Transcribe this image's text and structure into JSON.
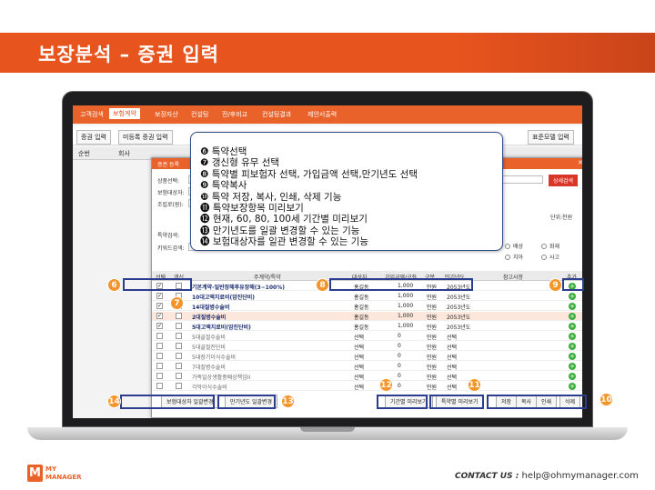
{
  "slide": {
    "title": "보장분석 – 증권 입력"
  },
  "app": {
    "nav": [
      "고객검색",
      "보험계약",
      "보장자산",
      "컨설팅",
      "전/후비교",
      "컨설팅결과",
      "제안서출력"
    ],
    "active_nav_index": 1,
    "sub_tabs": [
      "증권 입력",
      "미등록 증권 입력"
    ],
    "right_button": "표준모델 입력",
    "grid_headers": [
      "순번",
      "회사"
    ],
    "accent_color": "#e9622a"
  },
  "dialog": {
    "title": "증권 등록",
    "labels": [
      "상품선택:",
      "보험대상자:",
      "조립로(원):",
      "특약검색:",
      "키워드검색:"
    ],
    "search_button": "상세검색",
    "right_label": "단위:천원",
    "radio_options": [
      "배상",
      "화재",
      "치아",
      "사고"
    ],
    "table_headers": [
      "선택",
      "갱신",
      "주계약/특약",
      "대상자",
      "가입금액/구좌",
      "구분",
      "만기년도",
      "참고사항",
      "추가"
    ],
    "rows": [
      {
        "name": "기본계약-일반장해후유장해(3~100%)",
        "person": "홍길동",
        "amount": "1,000",
        "unit": "만원",
        "year": "2053년도",
        "checked": true,
        "bold": true,
        "selected": false
      },
      {
        "name": "10대고액치료비(암진단비)",
        "person": "홍길동",
        "amount": "1,000",
        "unit": "만원",
        "year": "2053년도",
        "checked": true,
        "bold": true,
        "selected": false
      },
      {
        "name": "14대질병수술비",
        "person": "홍길동",
        "amount": "1,000",
        "unit": "만원",
        "year": "2053년도",
        "checked": true,
        "bold": true,
        "selected": false
      },
      {
        "name": "2대질병수술비",
        "person": "홍길동",
        "amount": "1,000",
        "unit": "만원",
        "year": "2053년도",
        "checked": true,
        "bold": true,
        "selected": true
      },
      {
        "name": "5대고액치료비(암진단비)",
        "person": "홍길동",
        "amount": "1,000",
        "unit": "만원",
        "year": "2053년도",
        "checked": true,
        "bold": true,
        "selected": false
      },
      {
        "name": "5대골절수술비",
        "person": "선택",
        "amount": "0",
        "unit": "만원",
        "year": "선택",
        "checked": false,
        "bold": false,
        "selected": false
      },
      {
        "name": "5대골절진단비",
        "person": "선택",
        "amount": "0",
        "unit": "만원",
        "year": "선택",
        "checked": false,
        "bold": false,
        "selected": false
      },
      {
        "name": "5대장기이식수술비",
        "person": "선택",
        "amount": "0",
        "unit": "만원",
        "year": "선택",
        "checked": false,
        "bold": false,
        "selected": false
      },
      {
        "name": "7대질병수술비",
        "person": "선택",
        "amount": "0",
        "unit": "만원",
        "year": "선택",
        "checked": false,
        "bold": false,
        "selected": false
      },
      {
        "name": "가족일상생활중배상책임II",
        "person": "선택",
        "amount": "0",
        "unit": "만원",
        "year": "선택",
        "checked": false,
        "bold": false,
        "selected": false
      },
      {
        "name": "각막이식수술비",
        "person": "선택",
        "amount": "0",
        "unit": "만원",
        "year": "선택",
        "checked": false,
        "bold": false,
        "selected": false
      }
    ],
    "bottom_buttons": {
      "change_insured": "보험대상자 일괄변경",
      "change_year": "만기년도 일괄변경",
      "preview_term": "기간별 미리보기",
      "preview_rider": "특약별 미리보기",
      "save": "저장",
      "copy": "복사",
      "print": "인쇄",
      "delete": "삭제"
    }
  },
  "callout": {
    "items": [
      "❻ 특약선택",
      "❼ 갱신형 유무 선택",
      "❽ 특약별 피보험자 선택, 가입금액 선택,만기년도 선택",
      "❾ 특약복사",
      "❿ 특약 저장, 복사, 인쇄, 삭제 기능",
      "⓫ 특약보장항목 미리보기",
      "⓬ 현재, 60, 80, 100세 기간별 미리보기",
      "⓭ 만기년도를 일괄 변경할 수 있는 기능",
      "⓮ 보험대상자를 일관 변경할 수 있는 기능"
    ]
  },
  "markers": {
    "m6": "6",
    "m7": "7",
    "m8": "8",
    "m9": "9",
    "m10": "10",
    "m11": "11",
    "m12": "12",
    "m13": "13",
    "m14": "14"
  },
  "footer": {
    "logo_line1": "MY",
    "logo_line2": "MANAGER",
    "contact_label": "CONTACT US :",
    "contact_email": "help@ohmymanager.com"
  }
}
